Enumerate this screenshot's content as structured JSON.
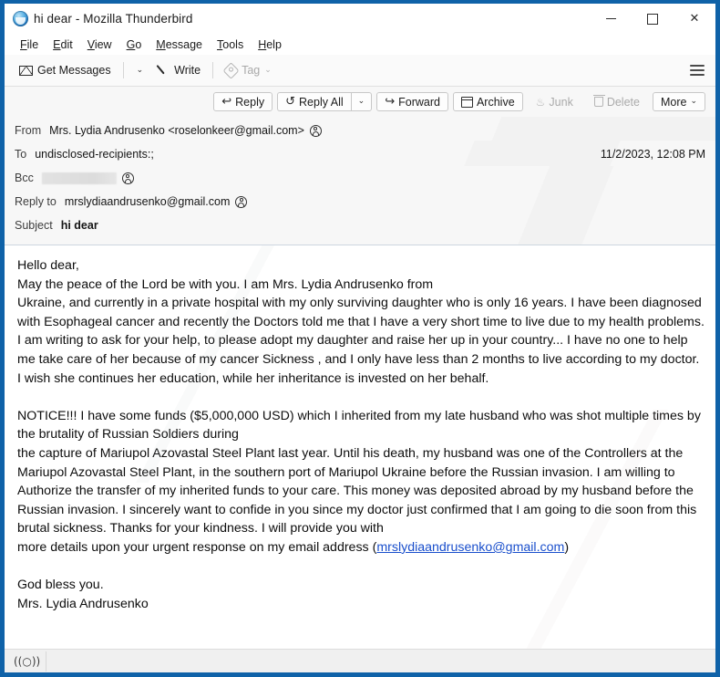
{
  "window": {
    "title": "hi dear - Mozilla Thunderbird",
    "logo_icon": "thunderbird-logo-icon",
    "controls": {
      "minimize": "minimize-icon",
      "maximize": "maximize-icon",
      "close": "✕"
    }
  },
  "menubar": {
    "items": [
      {
        "label": "File",
        "accel": "F"
      },
      {
        "label": "Edit",
        "accel": "E"
      },
      {
        "label": "View",
        "accel": "V"
      },
      {
        "label": "Go",
        "accel": "G"
      },
      {
        "label": "Message",
        "accel": "M"
      },
      {
        "label": "Tools",
        "accel": "T"
      },
      {
        "label": "Help",
        "accel": "H"
      }
    ]
  },
  "toolbar": {
    "get_messages_label": "Get Messages",
    "get_messages_icon": "envelope-download-icon",
    "get_messages_caret": "⌄",
    "write_label": "Write",
    "write_icon": "pencil-icon",
    "tag_label": "Tag",
    "tag_icon": "tag-icon",
    "tag_caret": "⌄",
    "app_menu_icon": "hamburger-menu-icon"
  },
  "message_actions": {
    "reply_label": "Reply",
    "reply_icon": "reply-arrow-icon",
    "reply_all_label": "Reply All",
    "reply_all_icon": "reply-all-arrow-icon",
    "reply_all_caret": "⌄",
    "forward_label": "Forward",
    "forward_icon": "forward-arrow-icon",
    "archive_label": "Archive",
    "archive_icon": "archive-box-icon",
    "junk_label": "Junk",
    "junk_icon": "junk-flame-icon",
    "delete_label": "Delete",
    "delete_icon": "trash-icon",
    "more_label": "More",
    "more_caret": "⌄"
  },
  "message_header": {
    "from_label": "From",
    "from_value": "Mrs. Lydia Andrusenko <roselonkeer@gmail.com>",
    "from_avatar_icon": "contact-avatar-icon",
    "to_label": "To",
    "to_value": "undisclosed-recipients:;",
    "date": "11/2/2023, 12:08 PM",
    "bcc_label": "Bcc",
    "bcc_value_redacted": "",
    "bcc_avatar_icon": "contact-avatar-icon",
    "reply_to_label": "Reply to",
    "reply_to_value": "mrslydiaandrusenko@gmail.com",
    "reply_to_avatar_icon": "contact-avatar-icon",
    "subject_label": "Subject",
    "subject_value": "hi dear"
  },
  "message_body": {
    "line_1": "Hello dear,",
    "line_2": "May the peace of the Lord be with you. I am Mrs. Lydia Andrusenko from",
    "line_3": "Ukraine, and currently in a private hospital with my only surviving daughter who is only 16 years. I have been diagnosed with Esophageal cancer and recently the Doctors told me that I have a very short time to live due to my health problems.",
    "line_4": "I am writing to ask for your help, to please adopt my daughter and raise her up in your country... I have no one to help me take care of her because of my cancer Sickness , and I only have less than 2 months to live according to my doctor. I wish she continues her education, while her inheritance is invested on her behalf.",
    "line_5": "NOTICE!!! I have some funds ($5,000,000 USD) which I inherited from my late husband who was shot multiple times by the brutality of Russian Soldiers during",
    "line_6": "the capture of Mariupol Azovastal Steel Plant last year. Until his death, my husband was one of the Controllers at the Mariupol Azovastal Steel Plant, in the southern port of Mariupol Ukraine before the Russian invasion. I am willing to Authorize the transfer of my inherited funds to your care. This money was deposited abroad by my husband before the Russian invasion. I sincerely want to confide in you since my doctor just confirmed that I am going to die soon from this brutal sickness. Thanks for your kindness. I will provide you with",
    "line_7_prefix": "more details upon your urgent response on my email address (",
    "line_7_link": "mrslydiaandrusenko@gmail.com",
    "line_7_suffix": ")",
    "line_8": "God bless you.",
    "line_9": "Mrs. Lydia Andrusenko"
  },
  "statusbar": {
    "online_icon": "((○))"
  },
  "colors": {
    "frame_blue": "#0f62a8",
    "header_bg": "#f7f7f7",
    "link_blue": "#1a4fcc",
    "body_bg": "#ffffff"
  }
}
